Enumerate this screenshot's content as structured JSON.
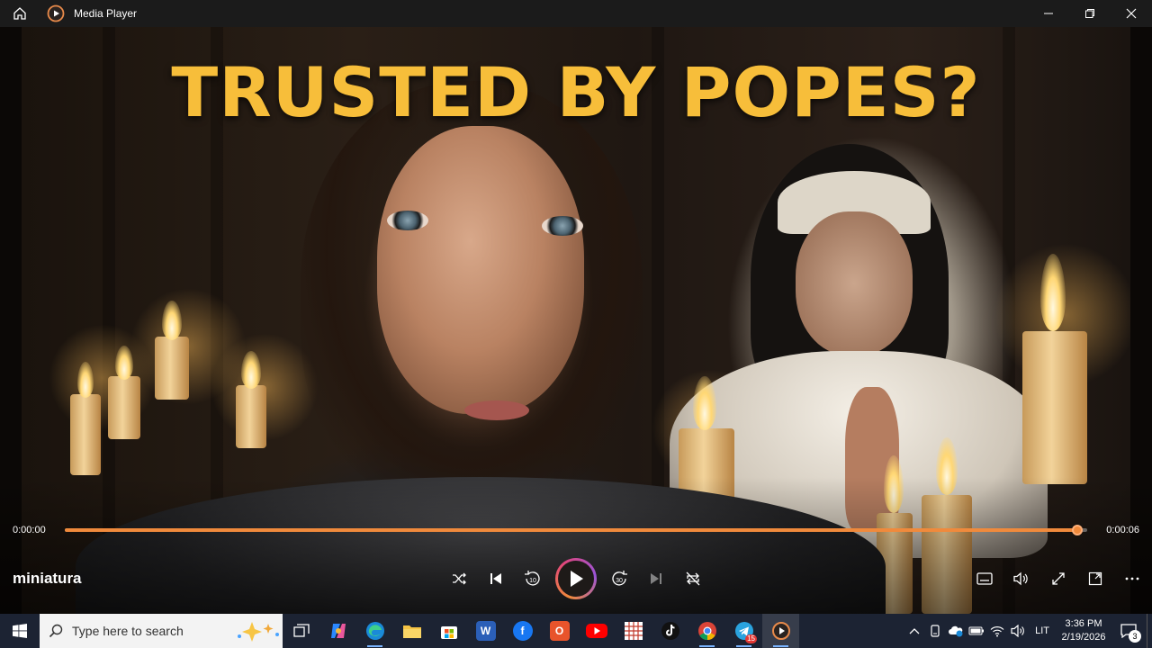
{
  "window": {
    "title": "Media Player",
    "controls": [
      "minimize-icon",
      "maximize-icon",
      "close-icon"
    ]
  },
  "video": {
    "overlay_text": "TRUSTED BY POPES?",
    "title": "miniatura",
    "time_current": "0:00:00",
    "time_total": "0:00:06",
    "progress": 0.99
  },
  "player_controls": {
    "left_group": [
      "shuffle-icon",
      "previous-icon",
      "rewind-10-icon",
      "play-icon",
      "forward-30-icon",
      "next-icon",
      "repeat-icon"
    ],
    "rewind_label": "10",
    "forward_label": "30",
    "right_group": [
      "subtitles-icon",
      "volume-icon",
      "fullscreen-icon",
      "miniplayer-icon",
      "more-icon"
    ]
  },
  "taskbar": {
    "search_placeholder": "Type here to search",
    "apps": [
      "task-view",
      "copilot",
      "edge",
      "file-explorer",
      "microsoft-store",
      "word",
      "facebook",
      "office",
      "youtube",
      "calendar-app",
      "tiktok",
      "chrome",
      "telegram",
      "media-player"
    ],
    "telegram_badge": "15",
    "tray": {
      "language": "LIT",
      "time": "3:36 PM",
      "date": "2/19/2026",
      "notification_count": "3"
    }
  },
  "colors": {
    "accent": "#f08a3c",
    "headline": "#f7be3a",
    "taskbar": "#1c2333"
  }
}
